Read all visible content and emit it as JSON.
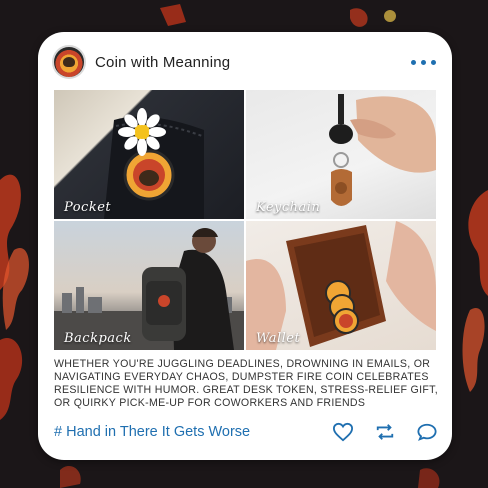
{
  "post": {
    "account_name": "Coin with Meanning",
    "photos": [
      {
        "label": "Pocket"
      },
      {
        "label": "Keychain"
      },
      {
        "label": "Backpack"
      },
      {
        "label": "Wallet"
      }
    ],
    "description": "WHETHER YOU'RE JUGGLING DEADLINES, DROWNING IN EMAILS, OR NAVIGATING EVERYDAY CHAOS, DUMPSTER FIRE COIN CELEBRATES RESILIENCE WITH HUMOR. GREAT DESK TOKEN, STRESS-RELIEF GIFT, OR QUIRKY PICK-ME-UP FOR COWORKERS AND FRIENDS",
    "hashtag": "# Hand in There It Gets Worse"
  },
  "icons": {
    "more": "more-dots-icon",
    "like": "heart-icon",
    "share": "repost-icon",
    "comment": "comment-icon"
  },
  "colors": {
    "accent": "#1f6fb0",
    "background": "#1b1618",
    "card": "#ffffff"
  }
}
